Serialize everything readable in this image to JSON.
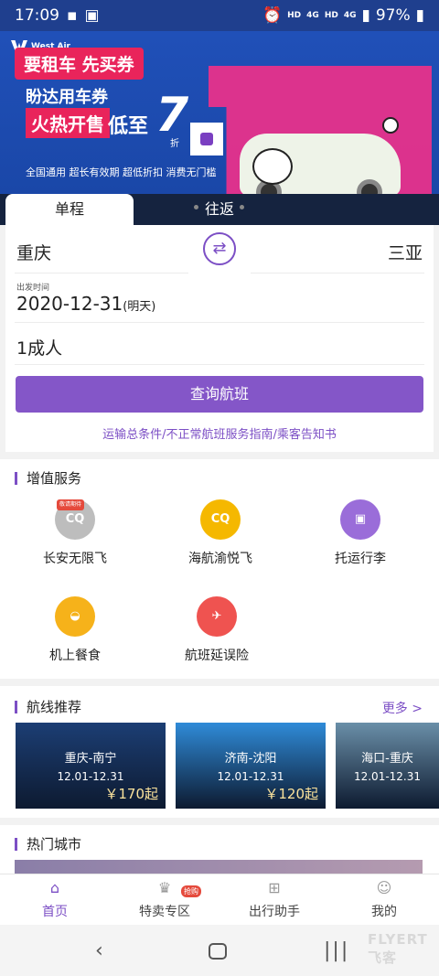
{
  "status_bar": {
    "time": "17:09",
    "network_1": "HD",
    "network_2": "HD",
    "net_4g_1": "4G",
    "net_4g_2": "4G",
    "battery": "97%"
  },
  "banner": {
    "brand": "West Air",
    "headline": "要租车 先买券",
    "line2": "盼达用车券",
    "tag": "火热开售",
    "low": "低至",
    "seven": "7",
    "zhe": "折",
    "sub": "全国通用  超长有效期  超低折扣  消费无门槛"
  },
  "tabs": {
    "oneway": "单程",
    "roundtrip": "往返"
  },
  "booking": {
    "from_city": "重庆",
    "to_city": "三亚",
    "swap_icon": "⇄",
    "date_label": "出发时间",
    "date": "2020-12-31",
    "date_hint": "(明天)",
    "passengers": "1成人",
    "search_button": "查询航班",
    "links": "运输总条件/不正常航班服务指南/乘客告知书"
  },
  "services": {
    "title": "增值服务",
    "items": [
      {
        "label": "长安无限飞",
        "icon": "cq-icon",
        "color": "#bdbdbd",
        "badge": "敬请期待",
        "glyph": "CQ"
      },
      {
        "label": "海航渝悦飞",
        "icon": "cq-icon",
        "color": "#f5b800",
        "badge": "",
        "glyph": "CQ"
      },
      {
        "label": "托运行李",
        "icon": "luggage-icon",
        "color": "#9a6dd9",
        "badge": "",
        "glyph": "▣"
      },
      {
        "label": "机上餐食",
        "icon": "cloche-icon",
        "color": "#f6b21a",
        "badge": "",
        "glyph": "◒"
      },
      {
        "label": "航班延误险",
        "icon": "shield-plane-icon",
        "color": "#ef5350",
        "badge": "",
        "glyph": "✈"
      }
    ]
  },
  "routes": {
    "title": "航线推荐",
    "more": "更多 >",
    "items": [
      {
        "name": "重庆-南宁",
        "dates": "12.01-12.31",
        "price": "￥170起",
        "color": "#1c3e74"
      },
      {
        "name": "济南-沈阳",
        "dates": "12.01-12.31",
        "price": "￥120起",
        "color": "#2f8bd8"
      },
      {
        "name": "海口-重庆",
        "dates": "12.01-12.31",
        "price": "",
        "color": "#6a8fa8"
      }
    ]
  },
  "hot_cities": {
    "title": "热门城市"
  },
  "nav": {
    "home": "首页",
    "deals": "特卖专区",
    "deals_badge": "抢购",
    "assistant": "出行助手",
    "me": "我的"
  },
  "watermark": "FLYERT 飞客"
}
